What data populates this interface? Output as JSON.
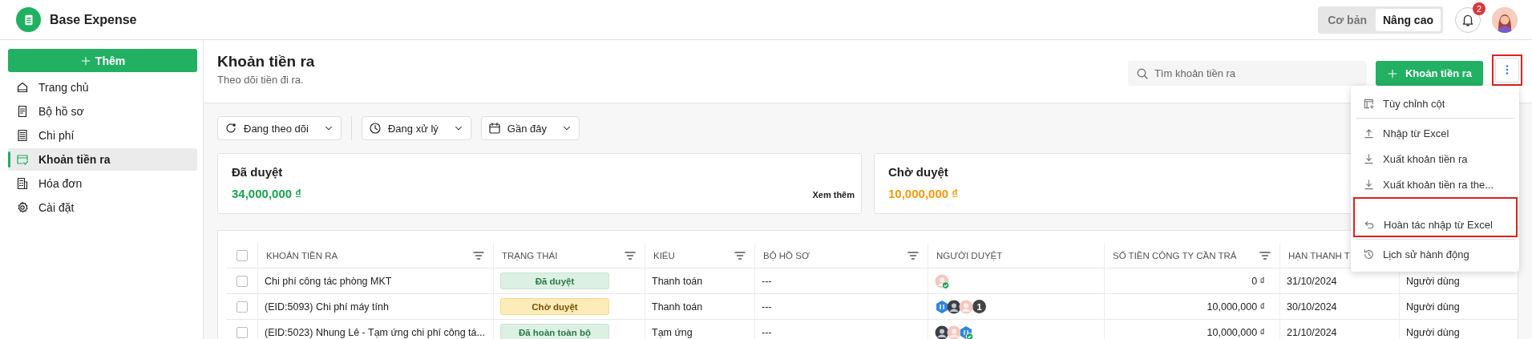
{
  "app": {
    "name": "Base Expense"
  },
  "mode_switch": [
    {
      "label": "Cơ bản",
      "selected": false
    },
    {
      "label": "Nâng cao",
      "selected": true
    }
  ],
  "notifications": {
    "count": "2"
  },
  "sidebar": {
    "add_button": "Thêm",
    "items": [
      {
        "label": "Trang chủ",
        "kind": "home",
        "selected": false
      },
      {
        "label": "Bộ hồ sơ",
        "kind": "folder",
        "selected": false
      },
      {
        "label": "Chi phí",
        "kind": "expense",
        "selected": false
      },
      {
        "label": "Khoản tiền ra",
        "kind": "payout",
        "selected": true
      },
      {
        "label": "Hóa đơn",
        "kind": "invoice",
        "selected": false
      },
      {
        "label": "Cài đặt",
        "kind": "settings",
        "selected": false
      }
    ]
  },
  "page": {
    "title": "Khoản tiền ra",
    "subtitle": "Theo dõi tiền đi ra.",
    "search": {
      "placeholder": "Tìm khoản tiền ra"
    },
    "add_button": "Khoản tiền ra",
    "more_button": {
      "highlighted": true
    }
  },
  "menu": {
    "groups": [
      [
        {
          "label": "Tùy chỉnh cột",
          "kind": "columns",
          "highlighted": false
        }
      ],
      [
        {
          "label": "Nhập từ Excel",
          "kind": "import",
          "highlighted": false
        },
        {
          "label": "Xuất khoản tiền ra",
          "kind": "export",
          "highlighted": false
        },
        {
          "label": "Xuất khoản tiền ra the...",
          "kind": "export",
          "highlighted": false
        },
        {
          "label": "Hoàn tác nhập từ Excel",
          "kind": "undo",
          "highlighted": true
        }
      ],
      [
        {
          "label": "Lịch sử hành động",
          "kind": "history",
          "highlighted": false
        }
      ]
    ]
  },
  "filters": [
    {
      "label": "Đang theo dõi",
      "kind": "follow"
    },
    {
      "label": "Đang xử lý",
      "kind": "clock"
    },
    {
      "label": "Gần đây",
      "kind": "calendar"
    }
  ],
  "summary_cards": [
    {
      "title": "Đã duyệt",
      "amount": "34,000,000 ₫",
      "color": "#1aa250",
      "link": "Xem thêm"
    },
    {
      "title": "Chờ duyệt",
      "amount": "10,000,000 ₫",
      "color": "#f59a0c"
    }
  ],
  "table": {
    "columns": [
      {
        "label": "KHOẢN TIỀN RA",
        "filterable": true
      },
      {
        "label": "TRẠNG THÁI",
        "filterable": true
      },
      {
        "label": "KIỂU",
        "filterable": true
      },
      {
        "label": "BỘ HỒ SƠ",
        "filterable": true
      },
      {
        "label": "NGƯỜI DUYỆT",
        "filterable": false
      },
      {
        "label": "SỐ TIỀN CÔNG TY CẦN TRẢ",
        "filterable": true
      },
      {
        "label": "HẠN THANH T",
        "filterable": false
      }
    ],
    "select_all_checked": false,
    "rows": [
      {
        "checked": false,
        "name": "Chi phí công tác phòng MKT",
        "status": {
          "label": "Đã duyệt",
          "kind": "approved"
        },
        "type": "Thanh toán",
        "dossier": "---",
        "approvers": [
          {
            "kind": "person",
            "color": "#f3c7c0",
            "approved": true
          }
        ],
        "amount": "0 ₫",
        "due": "31/10/2024",
        "column_9": "Người dùng"
      },
      {
        "checked": false,
        "name": "(EID:5093) Chi phí máy tính",
        "status": {
          "label": "Chờ duyệt",
          "kind": "pending"
        },
        "type": "Thanh toán",
        "dossier": "---",
        "approvers": [
          {
            "kind": "team",
            "color": "#2f86e0",
            "approved": false
          },
          {
            "kind": "person",
            "color": "#3a3f47",
            "approved": false
          },
          {
            "kind": "person",
            "color": "#f3c7c0",
            "approved": false
          },
          {
            "kind": "count",
            "label": "1"
          }
        ],
        "amount": "10,000,000 ₫",
        "due": "30/10/2024",
        "column_9": "Người dùng"
      },
      {
        "checked": false,
        "name": "(EID:5023) Nhung Lê - Tạm ứng chi phí công tá...",
        "status": {
          "label": "Đã hoàn toàn bộ",
          "kind": "approved"
        },
        "type": "Tạm ứng",
        "dossier": "---",
        "approvers": [
          {
            "kind": "person",
            "color": "#3a3f47",
            "approved": false
          },
          {
            "kind": "person",
            "color": "#f3c7c0",
            "approved": false
          },
          {
            "kind": "team",
            "color": "#2f86e0",
            "approved": true
          }
        ],
        "amount": "10,000,000 ₫",
        "due": "21/10/2024",
        "column_9": "Người dùng"
      }
    ]
  }
}
